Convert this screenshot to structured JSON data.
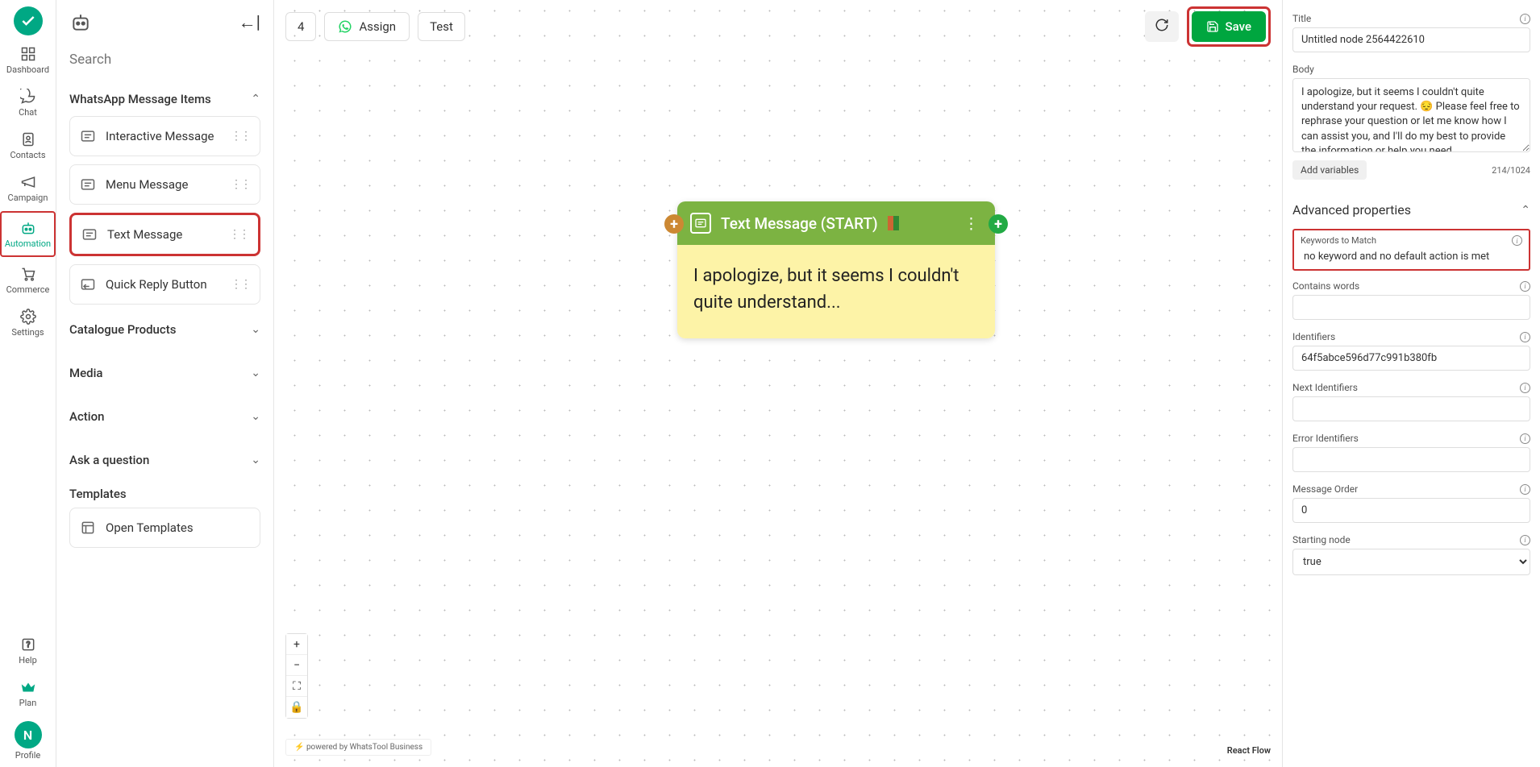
{
  "nav": {
    "items": [
      {
        "label": "Dashboard"
      },
      {
        "label": "Chat"
      },
      {
        "label": "Contacts"
      },
      {
        "label": "Campaign"
      },
      {
        "label": "Automation"
      },
      {
        "label": "Commerce"
      },
      {
        "label": "Settings"
      }
    ],
    "help": "Help",
    "plan": "Plan",
    "profile": "Profile",
    "avatar_letter": "N"
  },
  "panel": {
    "search_placeholder": "Search",
    "sections": {
      "whatsapp": {
        "title": "WhatsApp Message Items",
        "items": [
          "Interactive Message",
          "Menu Message",
          "Text Message",
          "Quick Reply Button"
        ]
      },
      "catalogue": "Catalogue Products",
      "media": "Media",
      "action": "Action",
      "ask": "Ask a question",
      "templates_label": "Templates",
      "open_templates": "Open Templates"
    }
  },
  "toolbar": {
    "count": "4",
    "assign": "Assign",
    "test": "Test",
    "save": "Save"
  },
  "node": {
    "title": "Text Message (START)",
    "body_preview": "I apologize, but it seems I couldn't quite understand..."
  },
  "props": {
    "title_label": "Title",
    "title_value": "Untitled node 2564422610",
    "body_label": "Body",
    "body_value": "I apologize, but it seems I couldn't quite understand your request. 😔 Please feel free to rephrase your question or let me know how I can assist you, and I'll do my best to provide the information or help you need",
    "add_variables": "Add variables",
    "char_count": "214/1024",
    "advanced": "Advanced properties",
    "keywords_label": "Keywords to Match",
    "keywords_value": "no keyword and no default action is met",
    "contains_label": "Contains words",
    "contains_value": "",
    "identifiers_label": "Identifiers",
    "identifiers_value": "64f5abce596d77c991b380fb",
    "next_identifiers_label": "Next Identifiers",
    "next_identifiers_value": "",
    "error_identifiers_label": "Error Identifiers",
    "error_identifiers_value": "",
    "message_order_label": "Message Order",
    "message_order_value": "0",
    "starting_node_label": "Starting node",
    "starting_node_value": "true"
  },
  "footer": {
    "powered": "powered by WhatsTool Business",
    "react_flow": "React Flow"
  }
}
